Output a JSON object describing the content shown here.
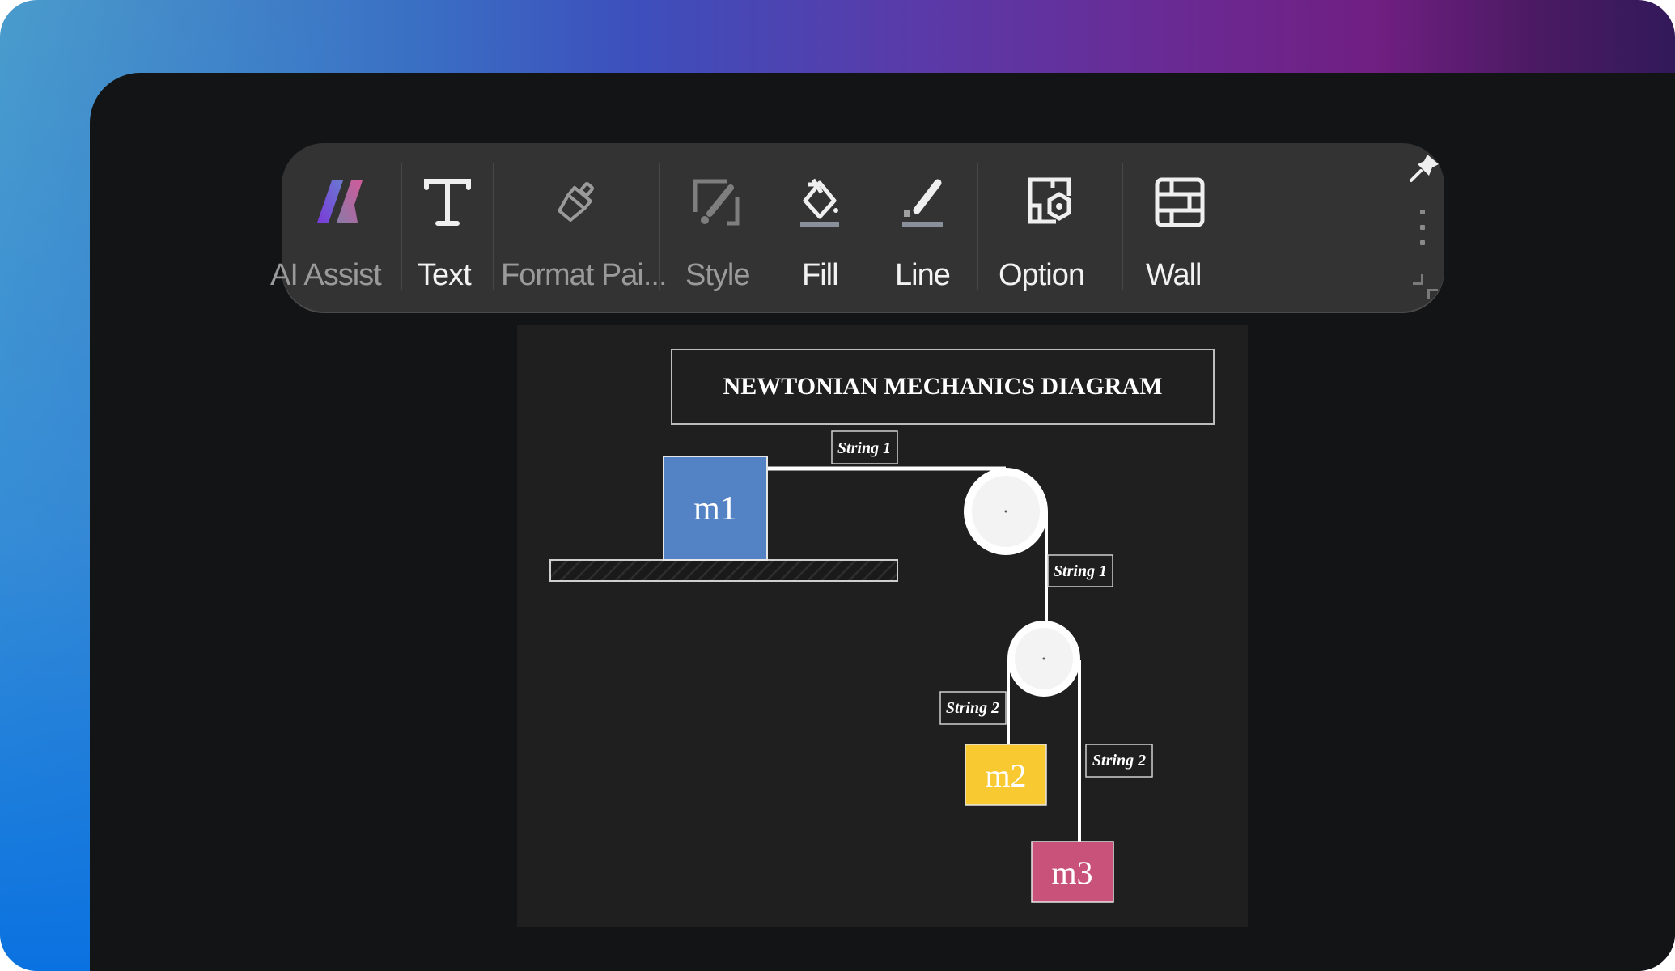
{
  "toolbar": {
    "items": [
      {
        "id": "ai-assist",
        "label": "AI Assist",
        "icon": "ai-assist-logo-icon",
        "enabled": false
      },
      {
        "id": "text",
        "label": "Text",
        "icon": "text-t-icon",
        "enabled": true
      },
      {
        "id": "format-painter",
        "label": "Format Pai...",
        "icon": "format-painter-brush-icon",
        "enabled": false
      },
      {
        "id": "style",
        "label": "Style",
        "icon": "style-brush-frame-icon",
        "enabled": false
      },
      {
        "id": "fill",
        "label": "Fill",
        "icon": "fill-bucket-icon",
        "enabled": true
      },
      {
        "id": "line",
        "label": "Line",
        "icon": "line-pen-icon",
        "enabled": true
      },
      {
        "id": "option",
        "label": "Option",
        "icon": "option-settings-icon",
        "enabled": true
      },
      {
        "id": "wall",
        "label": "Wall",
        "icon": "wall-bricks-icon",
        "enabled": true
      }
    ],
    "pin_icon": "pin-icon",
    "more_icon": "vertical-dots-icon"
  },
  "diagram": {
    "title": "NEWTONIAN MECHANICS DIAGRAM",
    "masses": [
      {
        "id": "m1",
        "label": "m1",
        "color": "#5383c4"
      },
      {
        "id": "m2",
        "label": "m2",
        "color": "#f8c930"
      },
      {
        "id": "m3",
        "label": "m3",
        "color": "#c8527a"
      }
    ],
    "string_labels": {
      "top": "String 1",
      "vertical": "String 1",
      "left_lower": "String 2",
      "right_lower": "String 2"
    },
    "pulleys": [
      "fixed-pulley",
      "movable-pulley"
    ],
    "surface": "hatched-ground"
  },
  "colors": {
    "canvas_bg": "#1f1f1f",
    "toolbar_bg": "#333333",
    "panel_bg": "#131415",
    "string": "#ffffff",
    "pulley": "#f4f4f4"
  }
}
